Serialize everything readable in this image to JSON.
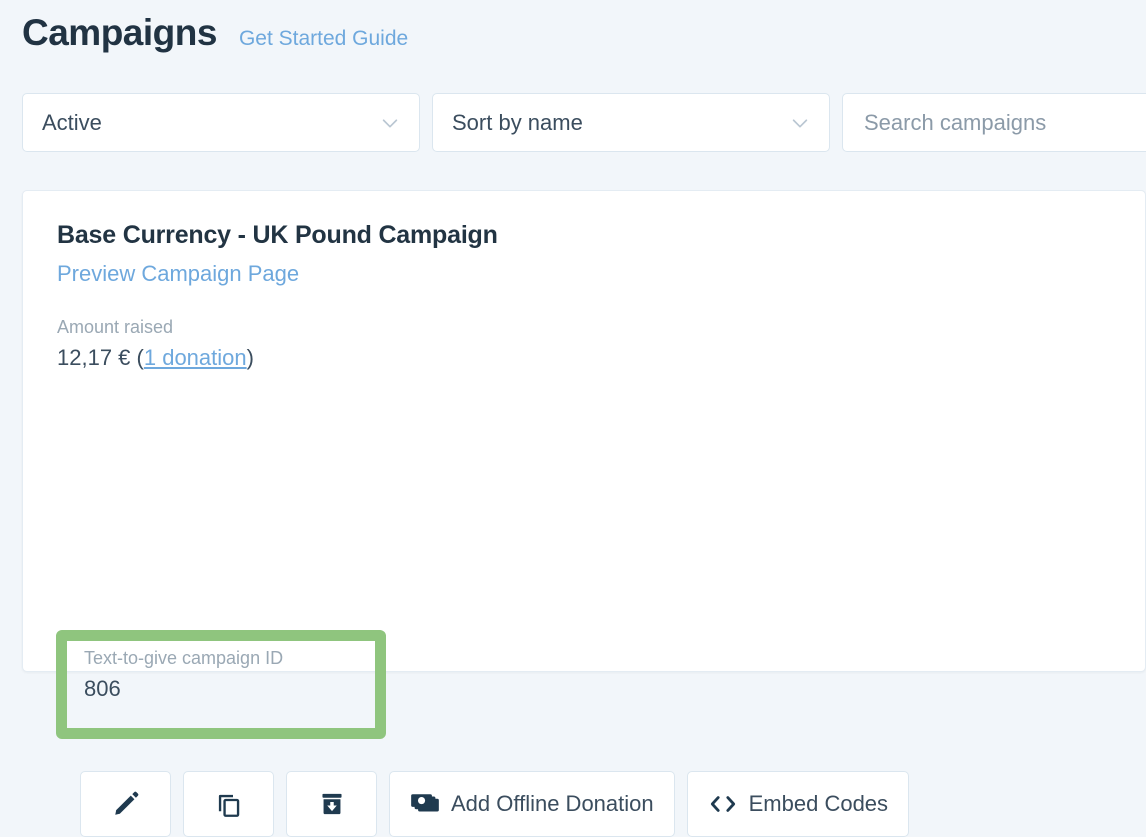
{
  "header": {
    "title": "Campaigns",
    "guide_link": "Get Started Guide"
  },
  "filters": {
    "status": {
      "value": "Active",
      "icon": "chevron-down-icon",
      "options": [
        "Active"
      ]
    },
    "sort": {
      "value": "Sort by name",
      "icon": "chevron-down-icon",
      "options": [
        "Sort by name"
      ]
    },
    "search": {
      "value": "",
      "placeholder": "Search campaigns"
    }
  },
  "campaign": {
    "name": "Base Currency - UK Pound Campaign",
    "preview_link": "Preview Campaign Page",
    "amount_raised": {
      "label": "Amount raised",
      "value": "12,17 €",
      "donations_prefix": " (",
      "donations_link": "1 donation",
      "donations_suffix": ")"
    },
    "text_to_give": {
      "label": "Text-to-give campaign ID",
      "value": "806",
      "highlighted": true,
      "highlight_color": "#8fc57e"
    },
    "actions": [
      {
        "name": "edit-button",
        "icon": "pencil-icon",
        "label": ""
      },
      {
        "name": "duplicate-button",
        "icon": "copy-icon",
        "label": ""
      },
      {
        "name": "archive-button",
        "icon": "archive-icon",
        "label": ""
      },
      {
        "name": "add-offline-donation-button",
        "icon": "money-bills-icon",
        "label": "Add Offline Donation"
      },
      {
        "name": "embed-codes-button",
        "icon": "code-brackets-icon",
        "label": "Embed Codes"
      }
    ]
  },
  "colors": {
    "page_background": "#f2f6fa",
    "card_background": "#ffffff",
    "text_primary": "#223443",
    "text_muted": "#9aa8b4",
    "link": "#6ea8dd",
    "highlight_green": "#8fc57e",
    "icon_navy": "#1f3a4f",
    "border": "#dbe6ef"
  }
}
